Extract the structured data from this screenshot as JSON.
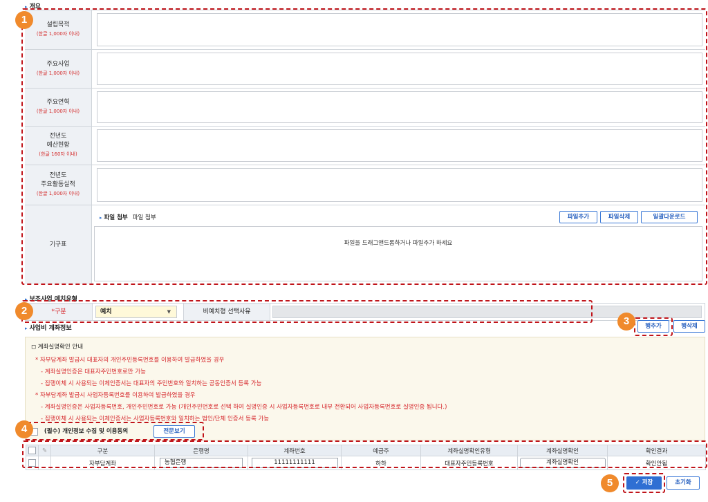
{
  "overview": {
    "title": "개요",
    "rows": [
      {
        "label": "설립목적",
        "sub": "(한글 1,000자 이내)"
      },
      {
        "label": "주요사업",
        "sub": "(한글 1,000자 이내)"
      },
      {
        "label": "주요연혁",
        "sub": "(한글 1,000자 이내)"
      },
      {
        "label": "전년도\n예산현황",
        "sub": "(한글 160자 이내)"
      },
      {
        "label": "전년도\n주요활동실적",
        "sub": "(한글 1,000자 이내)"
      }
    ],
    "org_label": "기구표",
    "file": {
      "title": "파일 첨부",
      "sub": "파일 첨부",
      "add": "파일추가",
      "delete": "파일삭제",
      "download_all": "일괄다운로드",
      "drop_hint": "파일을 드래그앤드롭하거나  파일추가 하세요"
    }
  },
  "subsidy": {
    "title": "보조사업 예치유형",
    "gubun_label": "*구분",
    "gubun_value": "예치",
    "reason_label": "비예치형 선택사유",
    "reason_value": ""
  },
  "account": {
    "title": "사업비 계좌정보",
    "add_row": "행추가",
    "delete_row": "행삭제",
    "notice_title": "계좌실명확인 안내",
    "lines": [
      {
        "t": "* 자부담계좌 발급시 대표자의 개인주민등록번호를 이용하여 발급하였을 경우",
        "c": "red"
      },
      {
        "t": "- 계좌실명인증은 대표자주민번호로만 가능",
        "c": "red"
      },
      {
        "t": "- 집행이체 시 사용되는 이체인증서는 대표자의 주민번호와 일치하는 공동인증서 등록 가능",
        "c": "red"
      },
      {
        "t": "* 자부담계좌 발급시 사업자등록번호를 이용하여 발급하였을 경우",
        "c": "red"
      },
      {
        "t": "- 계좌실명인증은 사업자등록번호, 개인주민번호로 가능 (개인주민번호로 선택 하여 실명인증 시 사업자등록번호로 내부 전환되어 사업자등록번호로 실명인증 됩니다.)",
        "c": "red"
      },
      {
        "t": "- 집행이체 시 사용되는 이체인증서는 사업자등록번호와 일치하는 법인/단체 인증서 등록 가능",
        "c": "red"
      }
    ],
    "consent_label": "(필수) 개인정보 수집 및 이용동의",
    "consent_button": "전문보기",
    "columns": [
      "구분",
      "은행명",
      "계좌번호",
      "예금주",
      "계좌실명확인유형",
      "계좌실명확인",
      "확인결과"
    ],
    "rows": [
      {
        "gubun": "자부담계좌",
        "bank": "농협은행",
        "account_no": "11111111111",
        "holder": "하하",
        "verify_type": "대표자주민등록번호",
        "verify_btn": "계좌실명확인",
        "result": "확인안됨"
      }
    ]
  },
  "footer": {
    "save": "저장",
    "reset": "초기화"
  },
  "badges": [
    "1",
    "2",
    "3",
    "4",
    "5"
  ]
}
